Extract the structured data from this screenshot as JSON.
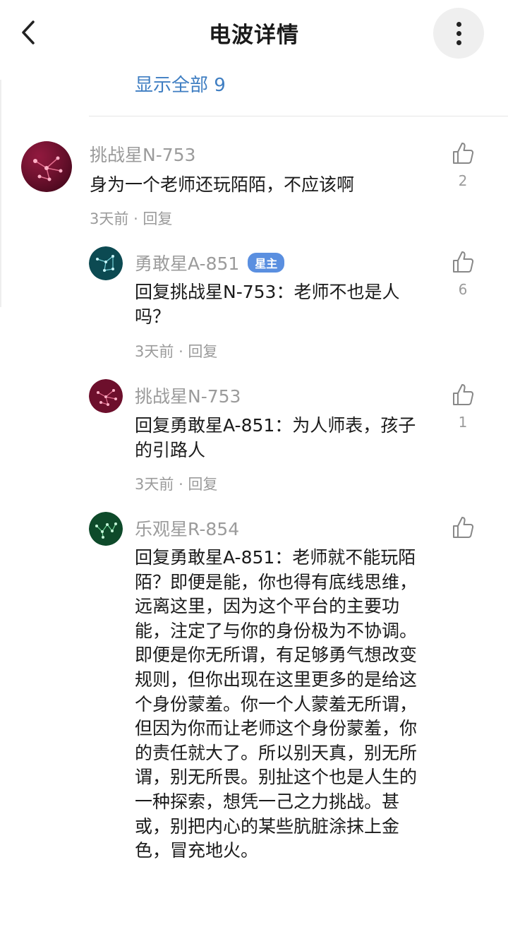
{
  "header": {
    "title": "电波详情"
  },
  "show_all": "显示全部 9",
  "comments": [
    {
      "name": "挑战星N-753",
      "text": "身为一个老师还玩陌陌，不应该啊",
      "time": "3天前",
      "reply": "回复",
      "likes": "2",
      "avatar_color": "#7a1030"
    },
    {
      "name": "勇敢星A-851",
      "badge": "星主",
      "text": "回复挑战星N-753：老师不也是人吗？",
      "time": "3天前",
      "reply": "回复",
      "likes": "6",
      "avatar_color": "#0d4d55"
    },
    {
      "name": "挑战星N-753",
      "text": "回复勇敢星A-851：为人师表，孩子的引路人",
      "time": "3天前",
      "reply": "回复",
      "likes": "1",
      "avatar_color": "#7a1030"
    },
    {
      "name": "乐观星R-854",
      "text": "回复勇敢星A-851：老师就不能玩陌陌？即便是能，你也得有底线思维，远离这里，因为这个平台的主要功能，注定了与你的身份极为不协调。即便是你无所谓，有足够勇气想改变规则，但你出现在这里更多的是给这个身份蒙羞。你一个人蒙羞无所谓，但因为你而让老师这个身份蒙羞，你的责任就大了。所以别天真，别无所谓，别无所畏。别扯这个也是人生的一种探索，想凭一己之力挑战。甚或，别把内心的某些肮脏涂抹上金色，冒充地火。",
      "avatar_color": "#0f4a2a"
    }
  ]
}
